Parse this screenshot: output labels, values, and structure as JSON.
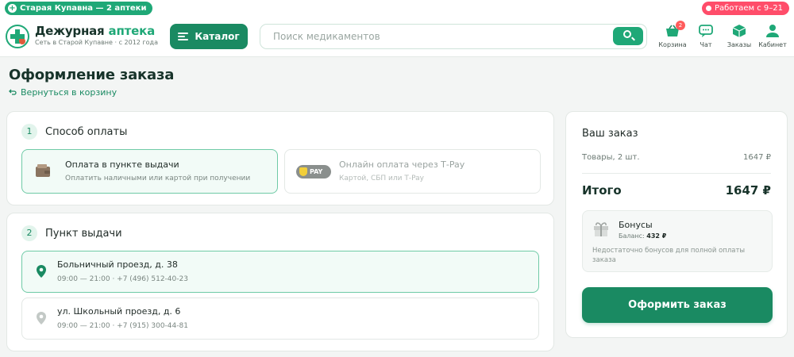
{
  "topbar": {
    "city": "Старая Купавна — 2 аптеки",
    "hours": "Работаем с 9–21"
  },
  "header": {
    "brand_main": "Дежурная",
    "brand_accent": "аптека",
    "brand_sub": "Сеть в Старой Купавне · с 2012 года",
    "catalog_label": "Каталог",
    "search_placeholder": "Поиск медикаментов",
    "nav": [
      {
        "label": "Корзина",
        "icon": "cart-icon",
        "badge": "2"
      },
      {
        "label": "Чат",
        "icon": "chat-icon"
      },
      {
        "label": "Заказы",
        "icon": "box-icon"
      },
      {
        "label": "Кабинет",
        "icon": "user-icon"
      }
    ]
  },
  "page": {
    "title": "Оформление заказа",
    "back_label": "Вернуться в корзину"
  },
  "payment": {
    "step": "1",
    "title": "Способ оплаты",
    "options": [
      {
        "title": "Оплата в пункте выдачи",
        "subtitle": "Оплатить наличными или картой при получении",
        "icon": "wallet-icon",
        "selected": true
      },
      {
        "title": "Онлайн оплата через T‑Pay",
        "subtitle": "Картой, СБП или T‑Pay",
        "icon": "tpay-icon",
        "badge": "PAY",
        "selected": false
      }
    ]
  },
  "pickup": {
    "step": "2",
    "title": "Пункт выдачи",
    "points": [
      {
        "address": "Больничный проезд, д. 38",
        "meta": "09:00 — 21:00 · +7 (496) 512-40-23",
        "selected": true
      },
      {
        "address": "ул. Школьный проезд, д. 6",
        "meta": "09:00 — 21:00 · +7 (915) 300-44-81",
        "selected": false
      }
    ]
  },
  "summary": {
    "title": "Ваш заказ",
    "items_label": "Товары, 2 шт.",
    "items_value": "1647 ₽",
    "total_label": "Итого",
    "total_value": "1647 ₽",
    "bonus_title": "Бонусы",
    "bonus_balance_label": "Баланс:",
    "bonus_balance_value": "432 ₽",
    "bonus_note": "Недостаточно бонусов для полной оплаты заказа",
    "checkout_label": "Оформить заказ"
  },
  "colors": {
    "brand": "#1a8a62",
    "accent": "#1fa877",
    "alert": "#ff4d6a",
    "selected_border": "#6fcaa6"
  }
}
